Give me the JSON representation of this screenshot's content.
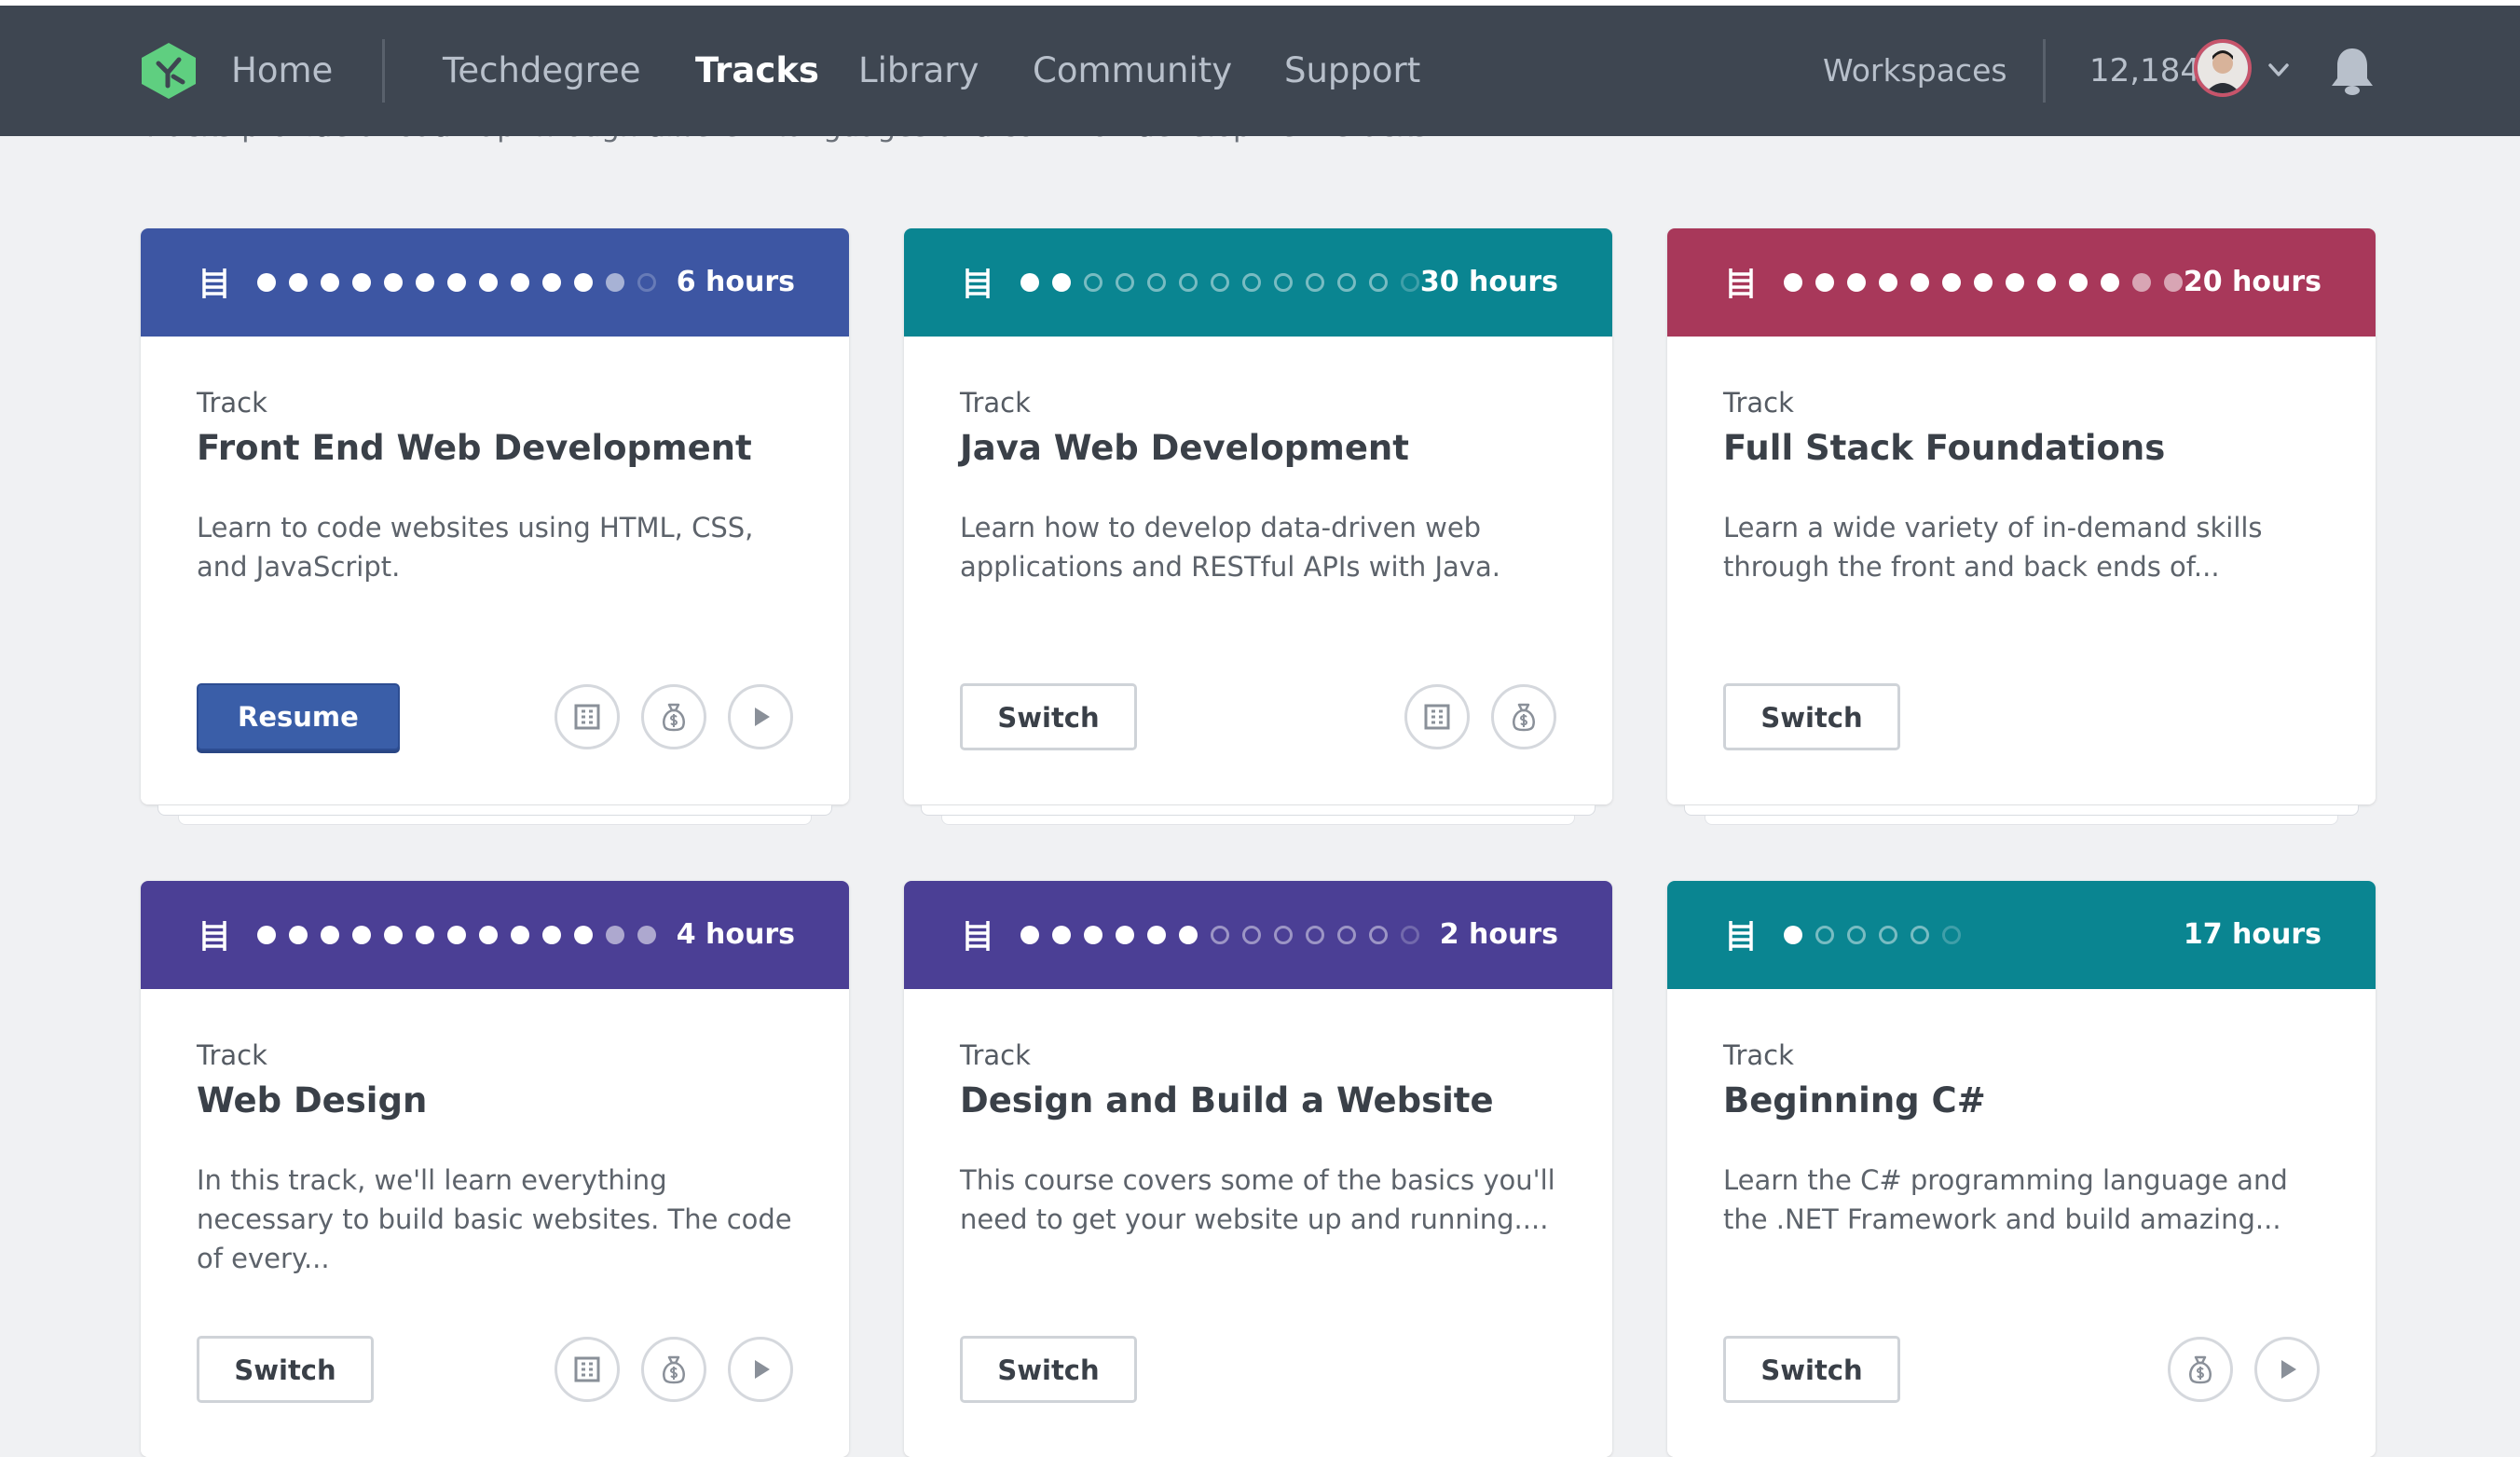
{
  "nav": {
    "links": [
      "Home",
      "Techdegree",
      "Tracks",
      "Library",
      "Community",
      "Support"
    ],
    "active": "Tracks",
    "workspaces": "Workspaces",
    "points": "12,184"
  },
  "intro_text": "Tracks provide a roadmap through different languages and common development stacks.",
  "colors": {
    "blue": "#3d56a3",
    "teal": "#0a8591",
    "red": "#a8385a",
    "purple": "#4b3f95",
    "navbar": "#3e4651"
  },
  "cards": [
    {
      "label": "Track",
      "title": "Front End Web Development",
      "description": "Learn to code websites using HTML, CSS, and JavaScript.",
      "hours": "6 hours",
      "button": "Resume",
      "button_style": "primary",
      "color": "#3d56a3",
      "progress": {
        "completed": 11,
        "partial": 1,
        "total": 13
      },
      "icons": [
        "company-icon",
        "money-bag-icon",
        "play-icon"
      ]
    },
    {
      "label": "Track",
      "title": "Java Web Development",
      "description": "Learn how to develop data-driven web applications and RESTful APIs with Java.",
      "hours": "30 hours",
      "button": "Switch",
      "button_style": "secondary",
      "color": "#0a8591",
      "progress": {
        "completed": 2,
        "partial": 0,
        "total": 13
      },
      "icons": [
        "company-icon",
        "money-bag-icon"
      ]
    },
    {
      "label": "Track",
      "title": "Full Stack Foundations",
      "description": "Learn a wide variety of in-demand skills through the front and back ends of...",
      "hours": "20 hours",
      "button": "Switch",
      "button_style": "secondary",
      "color": "#a8385a",
      "progress": {
        "completed": 11,
        "partial": 2,
        "total": 13
      },
      "icons": []
    },
    {
      "label": "Track",
      "title": "Web Design",
      "description": "In this track, we'll learn everything necessary to build basic websites. The code of every...",
      "hours": "4 hours",
      "button": "Switch",
      "button_style": "secondary",
      "color": "#4b3f95",
      "progress": {
        "completed": 11,
        "partial": 2,
        "total": 13
      },
      "icons": [
        "company-icon",
        "money-bag-icon",
        "play-icon"
      ]
    },
    {
      "label": "Track",
      "title": "Design and Build a Website",
      "description": "This course covers some of the basics you'll need to get your website up and running....",
      "hours": "2 hours",
      "button": "Switch",
      "button_style": "secondary",
      "color": "#4b3f95",
      "progress": {
        "completed": 6,
        "partial": 0,
        "total": 13
      },
      "icons": []
    },
    {
      "label": "Track",
      "title": "Beginning C#",
      "description": "Learn the C# programming language and the .NET Framework and build amazing...",
      "hours": "17 hours",
      "button": "Switch",
      "button_style": "secondary",
      "color": "#0a8591",
      "progress": {
        "completed": 1,
        "partial": 0,
        "total": 6
      },
      "icons": [
        "money-bag-icon",
        "play-icon"
      ]
    }
  ]
}
